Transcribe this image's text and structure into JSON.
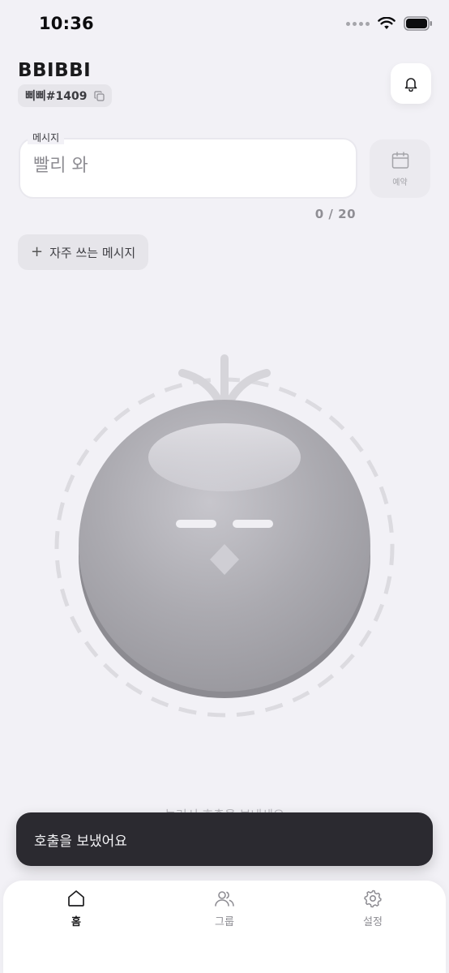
{
  "status_bar": {
    "time": "10:36"
  },
  "header": {
    "app_title": "BBIBBI",
    "user_tag": "삐삐#1409"
  },
  "message": {
    "legend": "메시지",
    "value": "",
    "placeholder": "빨리 와",
    "counter": "0 / 20",
    "schedule_label": "예약"
  },
  "favorites": {
    "plus": "+",
    "label": "자주 쓰는 메시지"
  },
  "call_button": {
    "hint": "눌러서 호출을 보내세요"
  },
  "toast": {
    "text": "호출을 보냈어요"
  },
  "tabbar": {
    "tabs": [
      {
        "label": "홈",
        "icon": "home-icon",
        "active": true
      },
      {
        "label": "그룹",
        "icon": "people-icon",
        "active": false
      },
      {
        "label": "설정",
        "icon": "gear-icon",
        "active": false
      }
    ]
  },
  "colors": {
    "background": "#f2f1f6",
    "toast_bg": "#2b2a30",
    "call_button": "#a9a8ae"
  }
}
